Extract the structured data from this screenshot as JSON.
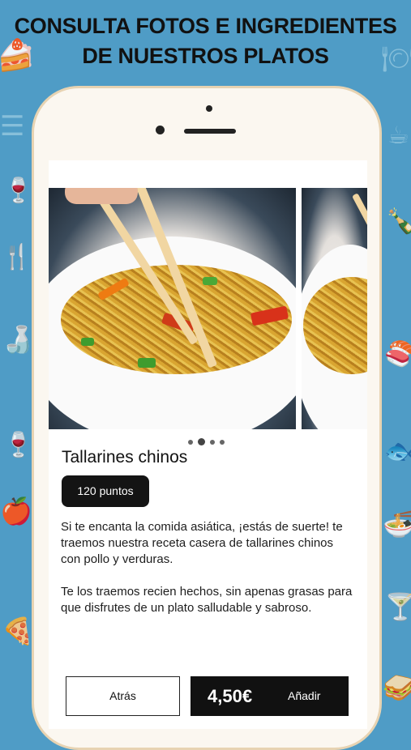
{
  "headline": {
    "line1": "CONSULTA FOTOS E INGREDIENTES",
    "line2": "DE NUESTROS PLATOS"
  },
  "product": {
    "name": "Tallarines chinos",
    "points": "120 puntos",
    "description_1": "Si te encanta la comida asiática, ¡estás de suerte! te traemos nuestra receta casera de tallarines chinos con pollo y verduras.",
    "description_2": "Te los traemos recien hechos, sin apenas grasas para que disfrutes de un plato salludable y sabroso.",
    "gallery": {
      "total": 4,
      "active_index": 1
    }
  },
  "actions": {
    "back_label": "Atrás",
    "price": "4,50€",
    "add_label": "Añadir"
  },
  "colors": {
    "background": "#4f9cc6",
    "button_dark": "#111111",
    "phone_frame": "#e7d3b2"
  }
}
